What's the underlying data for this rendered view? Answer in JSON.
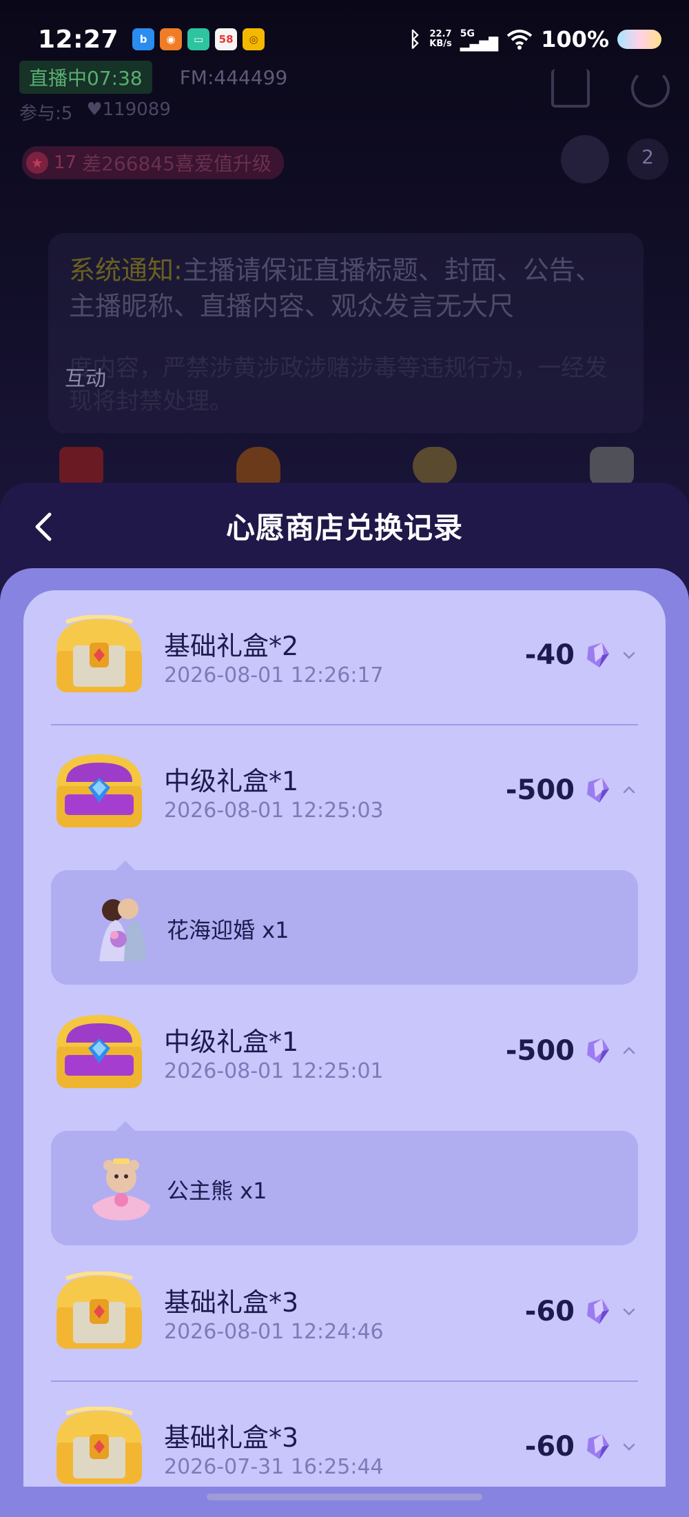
{
  "status_bar": {
    "time": "12:27",
    "apps": [
      "b",
      "◉",
      "▭",
      "58",
      "◎"
    ],
    "net_speed_value": "22.7",
    "net_speed_unit": "KB/s",
    "network": "5G",
    "battery": "100%"
  },
  "live": {
    "live_badge": "直播中07:38",
    "fm": "FM:444499",
    "participants": "参与:5",
    "likes": "119089",
    "level": "17",
    "level_text": "差266845喜爱值升级",
    "viewer_count": "2",
    "notice_label": "系统通知:",
    "notice_text": "主播请保证直播标题、封面、公告、主播昵称、直播内容、观众发言无大尺",
    "notice_more": "度内容，严禁涉黄涉政涉赌涉毒等违规行为，一经发现将封禁处理。",
    "interact_label": "互动"
  },
  "sheet": {
    "title": "心愿商店兑换记录"
  },
  "records": [
    {
      "title": "基础礼盒*2",
      "date": "2026-08-01 12:26:17",
      "amount": "-40",
      "expanded": false,
      "chest": "basic"
    },
    {
      "title": "中级礼盒*1",
      "date": "2026-08-01 12:25:03",
      "amount": "-500",
      "expanded": true,
      "chest": "mid",
      "gift": "花海迎婚 x1"
    },
    {
      "title": "中级礼盒*1",
      "date": "2026-08-01 12:25:01",
      "amount": "-500",
      "expanded": true,
      "chest": "mid",
      "gift": "公主熊 x1"
    },
    {
      "title": "基础礼盒*3",
      "date": "2026-08-01 12:24:46",
      "amount": "-60",
      "expanded": false,
      "chest": "basic"
    },
    {
      "title": "基础礼盒*3",
      "date": "2026-07-31 16:25:44",
      "amount": "-60",
      "expanded": false,
      "chest": "basic"
    }
  ],
  "colors": {
    "sheet_bg": "#1f1848",
    "body_bg": "#8783e0",
    "card_bg": "#c8c6fb",
    "expand_bg": "#b0adf1",
    "text_dark": "#1d1a4d",
    "text_date": "#7e7ab8"
  }
}
